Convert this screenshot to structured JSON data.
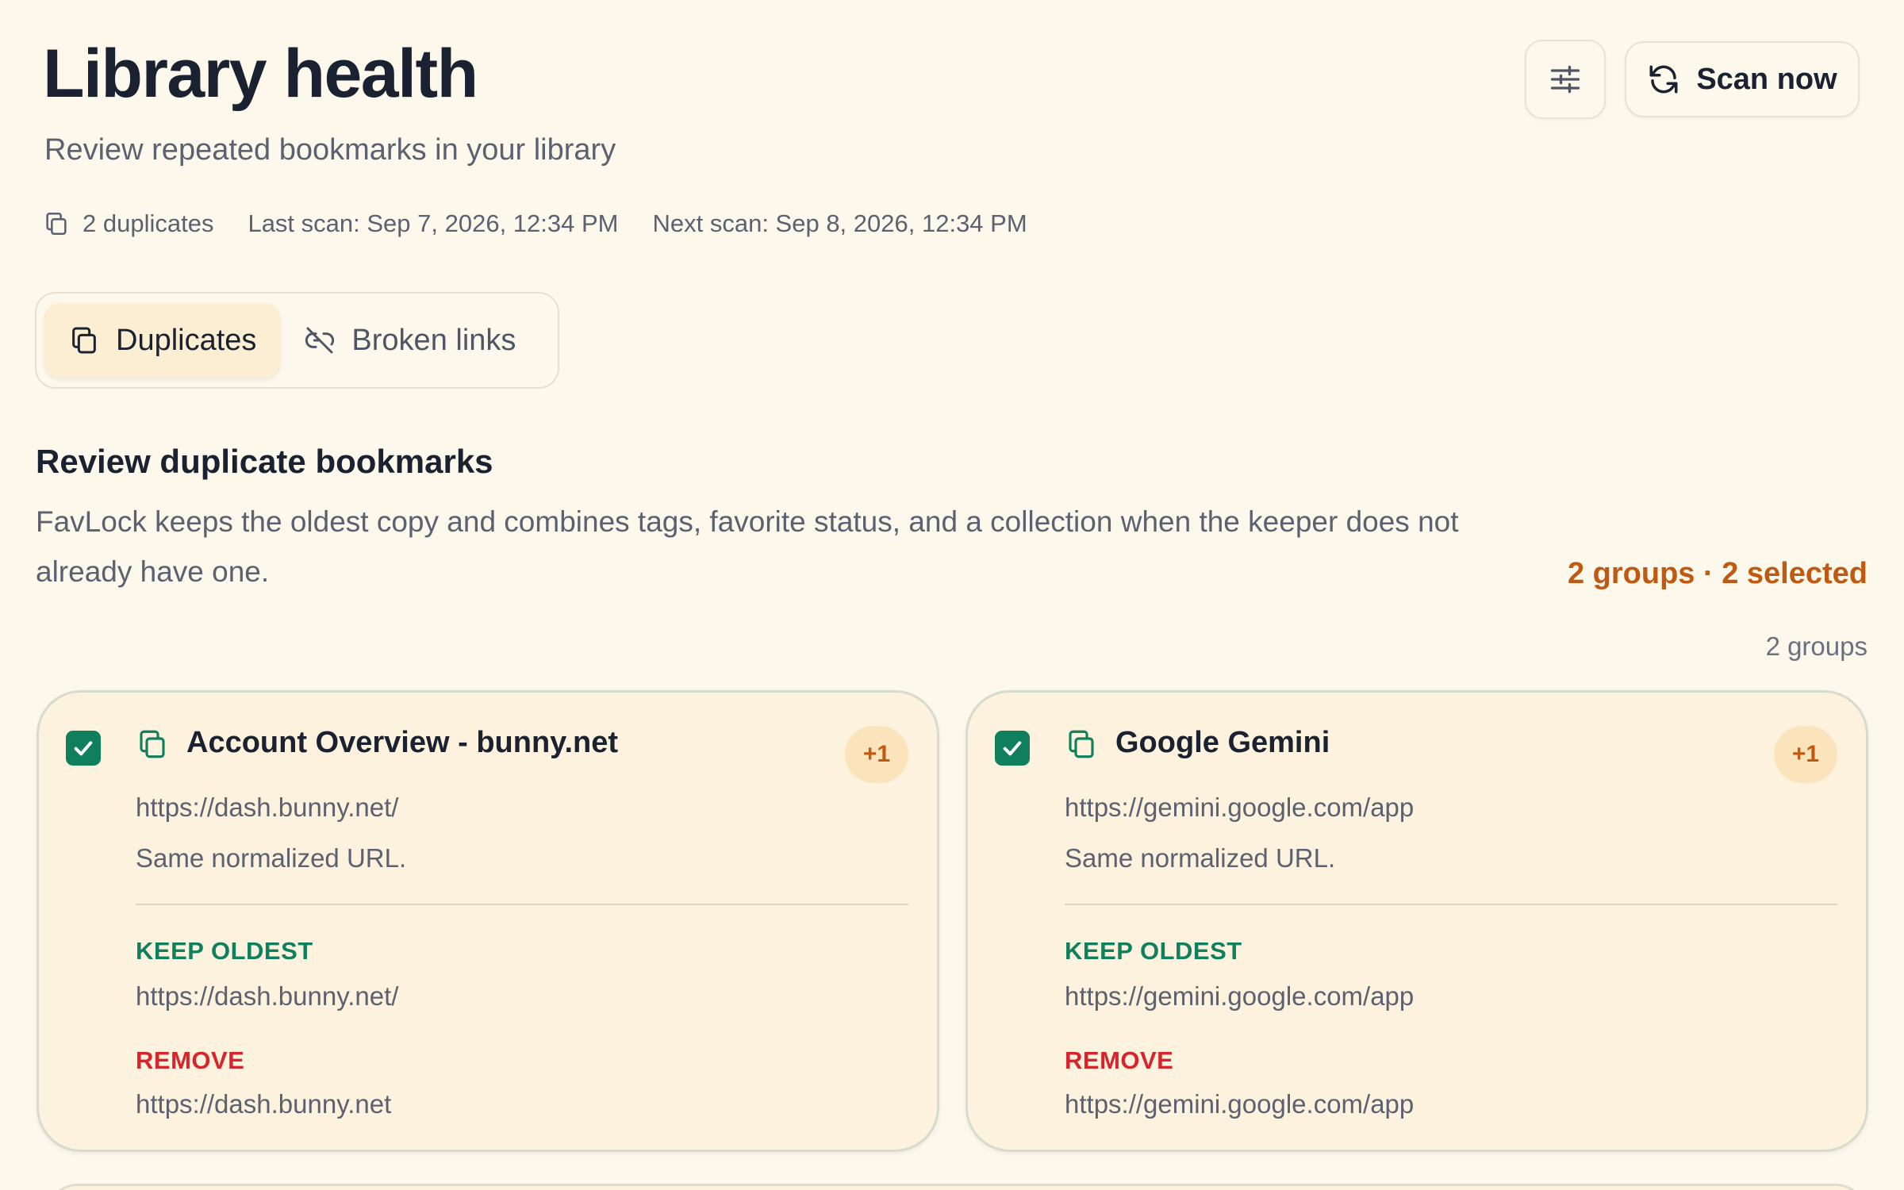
{
  "header": {
    "title": "Library health",
    "subtitle": "Review repeated bookmarks in your library",
    "scan_button_label": "Scan now",
    "filter_icon": "sliders-icon",
    "scan_icon": "refresh-icon"
  },
  "meta": {
    "duplicates": "2 duplicates",
    "last_scan": "Last scan: Sep 7, 2026, 12:34 PM",
    "next_scan": "Next scan: Sep 8, 2026, 12:34 PM",
    "duplicates_icon": "copy-icon"
  },
  "tabs": [
    {
      "label": "Duplicates",
      "icon": "copy-icon",
      "active": true
    },
    {
      "label": "Broken links",
      "icon": "broken-link-icon",
      "active": false
    }
  ],
  "section": {
    "title": "Review duplicate bookmarks",
    "description": "FavLock keeps the oldest copy and combines tags, favorite status, and a collection when the keeper does not already have one.",
    "selection_summary": "2 groups · 2 selected",
    "group_count": "2 groups"
  },
  "groups": [
    {
      "title": "Account Overview - bunny.net",
      "badge": "+1",
      "url": "https://dash.bunny.net/",
      "reason": "Same normalized URL.",
      "keep_label": "KEEP OLDEST",
      "keep_url": "https://dash.bunny.net/",
      "remove_label": "REMOVE",
      "remove_url": "https://dash.bunny.net",
      "selected": true
    },
    {
      "title": "Google Gemini",
      "badge": "+1",
      "url": "https://gemini.google.com/app",
      "reason": "Same normalized URL.",
      "keep_label": "KEEP OLDEST",
      "keep_url": "https://gemini.google.com/app",
      "remove_label": "REMOVE",
      "remove_url": "https://gemini.google.com/app",
      "selected": true
    }
  ],
  "colors": {
    "background": "#fdf8ec",
    "card": "#fdf2dd",
    "accent_orange": "#c05a12",
    "keep_green": "#0f7f5e",
    "remove_red": "#d8242c"
  }
}
